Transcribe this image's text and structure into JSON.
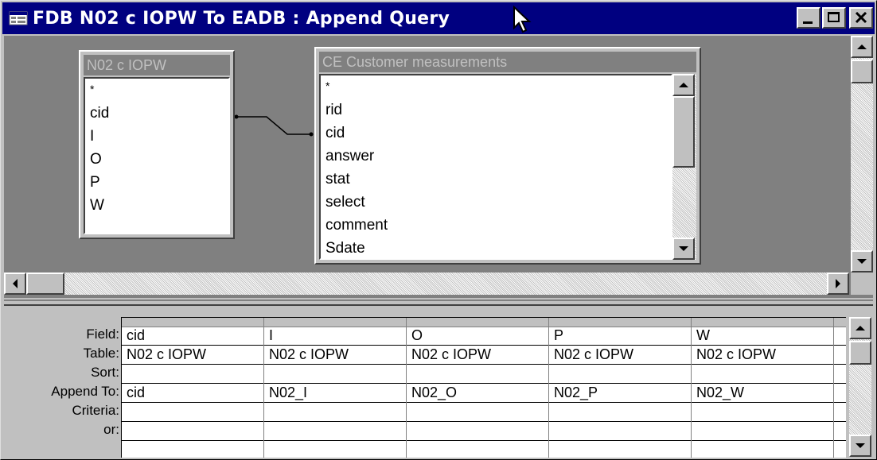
{
  "window": {
    "title": "FDB N02 c IOPW To EADB : Append Query",
    "buttons": [
      "minimize",
      "maximize",
      "close"
    ]
  },
  "tables": [
    {
      "name": "N02 c IOPW",
      "fields": [
        "*",
        "cid",
        "I",
        "O",
        "P",
        "W"
      ]
    },
    {
      "name": "CE Customer measurements",
      "fields": [
        "*",
        "rid",
        "cid",
        "answer",
        "stat",
        "select",
        "comment",
        "Sdate"
      ]
    }
  ],
  "grid": {
    "row_labels": [
      "Field:",
      "Table:",
      "Sort:",
      "Append To:",
      "Criteria:",
      "or:"
    ],
    "columns": [
      {
        "field": "cid",
        "table": "N02 c IOPW",
        "sort": "",
        "append_to": "cid",
        "criteria": "",
        "or": ""
      },
      {
        "field": "I",
        "table": "N02 c IOPW",
        "sort": "",
        "append_to": "N02_I",
        "criteria": "",
        "or": ""
      },
      {
        "field": "O",
        "table": "N02 c IOPW",
        "sort": "",
        "append_to": "N02_O",
        "criteria": "",
        "or": ""
      },
      {
        "field": "P",
        "table": "N02 c IOPW",
        "sort": "",
        "append_to": "N02_P",
        "criteria": "",
        "or": ""
      },
      {
        "field": "W",
        "table": "N02 c IOPW",
        "sort": "",
        "append_to": "N02_W",
        "criteria": "",
        "or": ""
      }
    ]
  },
  "icons": {
    "window_icon": "query-icon",
    "cursor": "mouse-pointer-icon"
  }
}
